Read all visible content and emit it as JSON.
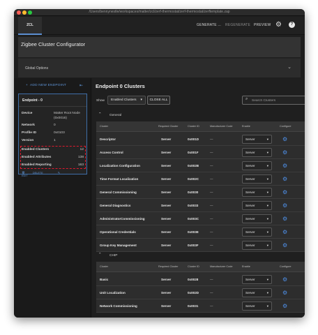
{
  "window": {
    "title": "/Users/bennynestle/workspaces/matter/zcl/zerf-thermostat/zerf-thermostat/zerftemplate.zap"
  },
  "appbar": {
    "tab_label": "ZCL",
    "generate_label": "GENERATE ...",
    "regenerate_label": "REGENERATE",
    "preview_label": "PREVIEW",
    "settings_icon": "gear-icon",
    "help_icon": "help-icon",
    "help_glyph": "?"
  },
  "header": {
    "title": "Zigbee Cluster Configurator"
  },
  "global_options": {
    "label": "Global Options"
  },
  "sidebar": {
    "add_endpoint_label": "ADD NEW ENDPOINT",
    "endpoint": {
      "title": "Endpoint - 0",
      "device_label": "Device",
      "device_value": "Matter Root Node (0x0016)",
      "network_label": "Network",
      "network_value": "0",
      "profile_label": "Profile ID",
      "profile_value": "0x0103",
      "version_label": "Version",
      "version_value": "1",
      "enabled_clusters_label": "Enabled Clusters",
      "enabled_clusters_value": "12",
      "enabled_attributes_label": "Enabled Attributes",
      "enabled_attributes_value": "138",
      "enabled_reporting_label": "Enabled Reporting",
      "enabled_reporting_value": "163",
      "delete_label": "DELETE",
      "edit_label": "EDIT"
    }
  },
  "main": {
    "title": "Endpoint 0 Clusters",
    "show_label": "Show",
    "show_value": "Enabled Clusters",
    "close_all_label": "CLOSE ALL",
    "search_placeholder": "Search Clusters",
    "columns": {
      "cluster": "Cluster",
      "required": "Required Cluster",
      "cluster_id": "Cluster ID",
      "manufacturer": "Manufacturer Code",
      "enable": "Enable",
      "configure": "Configure"
    },
    "sections": [
      {
        "name": "General",
        "rows": [
          {
            "cluster": "Descriptor",
            "required": "Server",
            "id": "0x001D",
            "mfr": "---",
            "enable": "Server"
          },
          {
            "cluster": "Access Control",
            "required": "Server",
            "id": "0x001F",
            "mfr": "---",
            "enable": "Server"
          },
          {
            "cluster": "Localization Configuration",
            "required": "Server",
            "id": "0x002B",
            "mfr": "---",
            "enable": "Server"
          },
          {
            "cluster": "Time Format Localization",
            "required": "Server",
            "id": "0x002C",
            "mfr": "---",
            "enable": "Server"
          },
          {
            "cluster": "General Commissioning",
            "required": "Server",
            "id": "0x0030",
            "mfr": "---",
            "enable": "Server"
          },
          {
            "cluster": "General Diagnostics",
            "required": "Server",
            "id": "0x0033",
            "mfr": "---",
            "enable": "Server"
          },
          {
            "cluster": "AdministratorCommissioning",
            "required": "Server",
            "id": "0x003C",
            "mfr": "---",
            "enable": "Server"
          },
          {
            "cluster": "Operational Credentials",
            "required": "Server",
            "id": "0x003E",
            "mfr": "---",
            "enable": "Server"
          },
          {
            "cluster": "Group Key Management",
            "required": "Server",
            "id": "0x003F",
            "mfr": "---",
            "enable": "Server"
          }
        ]
      },
      {
        "name": "CHIP",
        "rows": [
          {
            "cluster": "Basic",
            "required": "Server",
            "id": "0x0028",
            "mfr": "---",
            "enable": "Server"
          },
          {
            "cluster": "Unit Localization",
            "required": "Server",
            "id": "0x002D",
            "mfr": "---",
            "enable": "Server"
          },
          {
            "cluster": "Network Commissioning",
            "required": "Server",
            "id": "0x0031",
            "mfr": "---",
            "enable": "Server"
          }
        ]
      }
    ]
  },
  "colors": {
    "accent": "#4f91ea",
    "highlight": "#e0192e",
    "background": "#1e1e1e"
  }
}
